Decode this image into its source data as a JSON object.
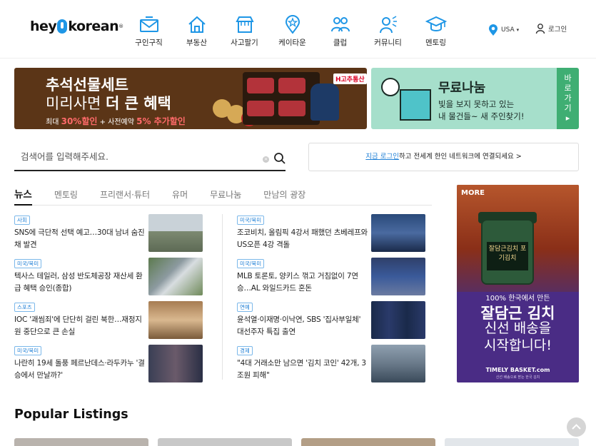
{
  "brand": {
    "logo_pre": "hey",
    "logo_post": "korean"
  },
  "nav": [
    {
      "label": "구인구직",
      "icon": "mail-icon"
    },
    {
      "label": "부동산",
      "icon": "house-icon"
    },
    {
      "label": "사고팔기",
      "icon": "shop-icon"
    },
    {
      "label": "케이타운",
      "icon": "pin-star-icon"
    },
    {
      "label": "클럽",
      "icon": "people-icon"
    },
    {
      "label": "커뮤니티",
      "icon": "speaker-person-icon"
    },
    {
      "label": "멘토링",
      "icon": "graduation-cap-icon"
    }
  ],
  "header": {
    "region": "USA",
    "login": "로그인"
  },
  "banner_left": {
    "title1": "추석선물세트",
    "title2_pre": "미리사면 ",
    "title2_bold": "더 큰 혜택",
    "sub_pre": "최대 ",
    "sub_em1": "30%할인",
    "sub_mid": " + 사전예약 ",
    "sub_em2": "5% 추가할인",
    "brand": "H고추통산"
  },
  "banner_right": {
    "title": "무료나눔",
    "desc1": "빛을 보지 못하고 있는",
    "desc2": "내 물건들~ 새 주인찾기!",
    "side": "바로가기 ▸"
  },
  "search": {
    "placeholder": "검색어를 입력해주세요."
  },
  "login_prompt": {
    "link": "지금 로그인",
    "rest": "하고 전세계 한인 네트워크에 연결되세요 >"
  },
  "tabs": [
    "뉴스",
    "멘토링",
    "프리랜서·튜터",
    "유머",
    "무료나눔",
    "만남의 광장"
  ],
  "news_left": [
    {
      "tag": "사회",
      "headline": "SNS에 극단적 선택 예고…30대 남녀 숨진 채 발견"
    },
    {
      "tag": "미국/북미",
      "headline": "텍사스 테일러, 삼성 반도체공장 재산세 환급 혜택 승인(종합)"
    },
    {
      "tag": "스포츠",
      "headline": "IOC '괘씸죄'에 단단히 걸린 북한…재정지원 중단으로 큰 손실"
    },
    {
      "tag": "미국/북미",
      "headline": "나란히 19세 돌풍 페르난데스·라두카누 '결승에서 만날까?'"
    }
  ],
  "news_right": [
    {
      "tag": "미국/북미",
      "headline": "조코비치, 올림픽 4강서 패했던 츠베레프와 US오픈 4강 격돌"
    },
    {
      "tag": "미국/북미",
      "headline": "MLB 토론토, 양키스 꺾고 거침없이 7연승…AL 와일드카드 혼돈"
    },
    {
      "tag": "연예",
      "headline": "윤석열·이재명·이낙연, SBS '집사부일체' 대선주자 특집 출연"
    },
    {
      "tag": "경제",
      "headline": "\"4대 거래소만 남으면 '김치 코인' 42개, 3조원 피해\""
    }
  ],
  "ad": {
    "more": "MORE",
    "jar_label": "잘담근김치 포기김치",
    "line1": "100% 한국에서 만든",
    "line2": "잘담근 김치",
    "line3a": "신선 배송을",
    "line3b": "시작합니다!",
    "brand": "TIMELY BASKET.com",
    "fine": "신선 배송으로 받는 한국 김치"
  },
  "popular": {
    "title": "Popular Listings"
  },
  "colors": {
    "accent": "#1e96e6",
    "link": "#1e7fd6",
    "green": "#3fae73",
    "ad_purple": "#4a2c85"
  }
}
